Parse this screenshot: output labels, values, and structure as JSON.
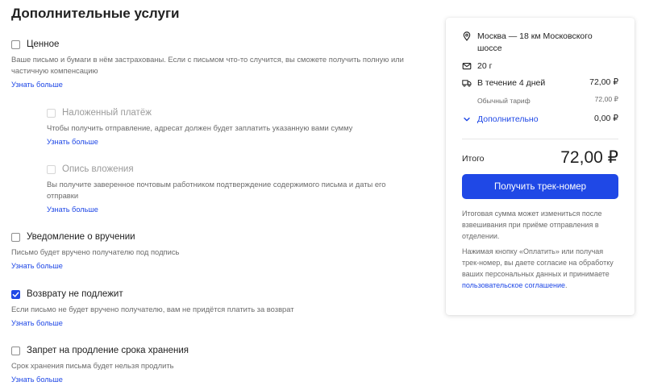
{
  "section_title": "Дополнительные услуги",
  "options": {
    "valuable": {
      "label": "Ценное",
      "desc": "Ваше письмо и бумаги в нём застрахованы. Если с письмом что-то случится, вы сможете получить полную или частичную компенсацию",
      "learn_more": "Узнать больше",
      "checked": false,
      "disabled": false
    },
    "cod": {
      "label": "Наложенный платёж",
      "desc": "Чтобы получить отправление, адресат должен будет заплатить указанную вами сумму",
      "learn_more": "Узнать больше",
      "checked": false,
      "disabled": true
    },
    "inventory": {
      "label": "Опись вложения",
      "desc": "Вы получите заверенное почтовым работником подтверждение содержимого письма и даты его отправки",
      "learn_more": "Узнать больше",
      "checked": false,
      "disabled": true
    },
    "delivery_notice": {
      "label": "Уведомление о вручении",
      "desc": "Письмо будет вручено получателю под подпись",
      "learn_more": "Узнать больше",
      "checked": false,
      "disabled": false
    },
    "no_return": {
      "label": "Возврату не подлежит",
      "desc": "Если письмо не будет вручено получателю, вам не придётся платить за возврат",
      "learn_more": "Узнать больше",
      "checked": true,
      "disabled": false
    },
    "no_extension": {
      "label": "Запрет на продление срока хранения",
      "desc": "Срок хранения письма будет нельзя продлить",
      "learn_more": "Узнать больше",
      "checked": false,
      "disabled": false
    }
  },
  "summary": {
    "route": "Москва — 18 км Московского шоссе",
    "weight": "20 г",
    "delivery_time": "В течение 4 дней",
    "delivery_price": "72,00 ₽",
    "tariff_label": "Обычный тариф",
    "tariff_price": "72,00 ₽",
    "extra_label": "Дополнительно",
    "extra_price": "0,00 ₽",
    "total_label": "Итого",
    "total_value": "72,00 ₽",
    "cta_label": "Получить трек-номер",
    "note1": "Итоговая сумма может измениться после взвешивания при приёме отправления в отделении.",
    "note2_prefix": "Нажимая кнопку «Оплатить» или получая трек-номер, вы даете согласие на обработку ваших персональных данных и принимаете ",
    "note2_link": "пользовательское соглашение",
    "note2_suffix": "."
  },
  "colors": {
    "accent": "#1f48e6",
    "muted": "#6b6b6b"
  },
  "icons": [
    "location-pin-icon",
    "envelope-icon",
    "truck-icon",
    "chevron-down-icon",
    "checkmark-icon"
  ]
}
